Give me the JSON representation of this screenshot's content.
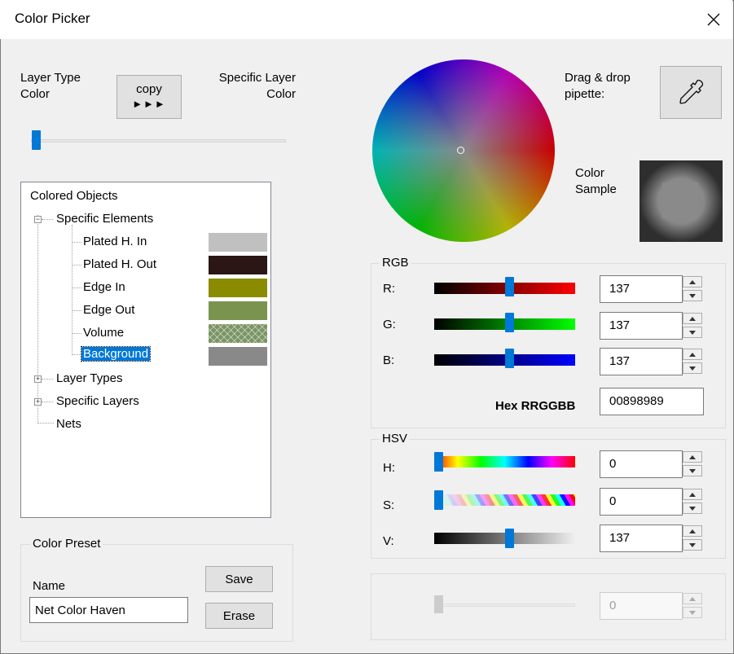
{
  "window": {
    "title": "Color Picker"
  },
  "left": {
    "layer_type_color": "Layer Type\nColor",
    "copy_label": "copy",
    "copy_arrows": "►►►",
    "specific_layer_color": "Specific Layer\nColor",
    "slider_value_fraction": 0.0
  },
  "tree": {
    "root": "Colored Objects",
    "specific_elements": "Specific Elements",
    "items": [
      {
        "label": "Plated H. In",
        "color": "#c0c0c0"
      },
      {
        "label": "Plated H. Out",
        "color": "#2b1515"
      },
      {
        "label": "Edge In",
        "color": "#8b8b00"
      },
      {
        "label": "Edge Out",
        "color": "#7a9450"
      },
      {
        "label": "Volume",
        "color": "#7a9464",
        "pattern": "crosshatch"
      },
      {
        "label": "Background",
        "color": "#898989",
        "selected": true
      }
    ],
    "layer_types": "Layer Types",
    "specific_layers": "Specific Layers",
    "nets": "Nets"
  },
  "preset": {
    "group_label": "Color Preset",
    "name_label": "Name",
    "name_value": "Net Color Haven",
    "save_label": "Save",
    "erase_label": "Erase"
  },
  "right": {
    "pipette_label": "Drag & drop\npipette:",
    "sample_label": "Color\nSample",
    "sample_color": "#898989"
  },
  "rgb": {
    "group_label": "RGB",
    "r_label": "R:",
    "g_label": "G:",
    "b_label": "B:",
    "r": "137",
    "g": "137",
    "b": "137",
    "hex_label": "Hex RRGGBB",
    "hex": "00898989"
  },
  "hsv": {
    "group_label": "HSV",
    "h_label": "H:",
    "s_label": "S:",
    "v_label": "V:",
    "h": "0",
    "s": "0",
    "v": "137"
  },
  "alpha": {
    "value": "0"
  }
}
